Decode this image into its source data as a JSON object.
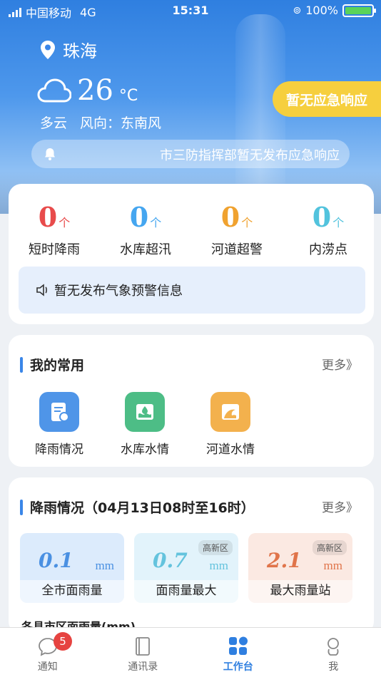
{
  "status_bar": {
    "carrier": "中国移动",
    "network": "4G",
    "time": "15:31",
    "battery": "100%"
  },
  "location": {
    "city": "珠海"
  },
  "weather": {
    "temperature": "26",
    "unit": "°C",
    "condition": "多云",
    "wind": "风向：东南风"
  },
  "emergency": {
    "label": "暂无应急响应",
    "notice": "市三防指挥部暂无发布应急响应"
  },
  "stats": [
    {
      "value": "0",
      "unit": "个",
      "label": "短时降雨",
      "color": "#e84b4b"
    },
    {
      "value": "0",
      "unit": "个",
      "label": "水库超汛",
      "color": "#45a6f0"
    },
    {
      "value": "0",
      "unit": "个",
      "label": "河道超警",
      "color": "#f0a22f"
    },
    {
      "value": "0",
      "unit": "个",
      "label": "内涝点",
      "color": "#52c3dd"
    }
  ],
  "warning": {
    "text": "暂无发布气象预警信息"
  },
  "favorites": {
    "title": "我的常用",
    "more": "更多》",
    "items": [
      {
        "label": "降雨情况",
        "icon": "rain-report-icon",
        "color": "#4f95e8"
      },
      {
        "label": "水库水情",
        "icon": "reservoir-icon",
        "color": "#4dbd86"
      },
      {
        "label": "河道水情",
        "icon": "river-wave-icon",
        "color": "#f3b14d"
      }
    ]
  },
  "rainfall": {
    "title": "降雨情况（04月13日08时至16时）",
    "more": "更多》",
    "cards": [
      {
        "value": "0.1",
        "unit": "mm",
        "tag": "",
        "label": "全市面雨量",
        "bg": "#dcebfc",
        "color": "#4a90e2"
      },
      {
        "value": "0.7",
        "unit": "mm",
        "tag": "高新区",
        "label": "面雨量最大",
        "bg": "#e2f3fb",
        "color": "#64c3dd"
      },
      {
        "value": "2.1",
        "unit": "mm",
        "tag": "高新区",
        "label": "最大雨量站",
        "bg": "#fbe9e2",
        "color": "#e0744a"
      }
    ],
    "next_section": "各县市区面雨量(mm)"
  },
  "tabs": [
    {
      "label": "通知",
      "badge": "5",
      "icon": "notification-icon"
    },
    {
      "label": "通讯录",
      "icon": "contacts-icon"
    },
    {
      "label": "工作台",
      "icon": "workbench-icon",
      "active": true
    },
    {
      "label": "我",
      "icon": "profile-icon"
    }
  ]
}
